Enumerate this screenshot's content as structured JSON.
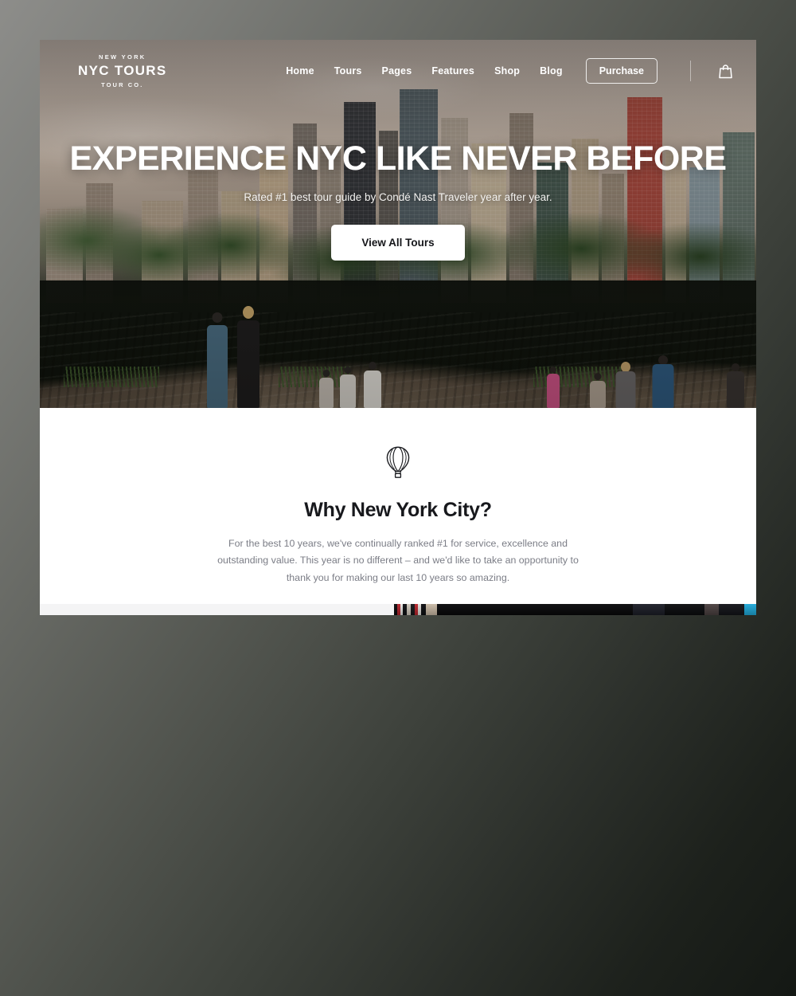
{
  "brand": {
    "top_line": "NEW YORK",
    "name": "NYC TOURS",
    "sub_line": "TOUR CO."
  },
  "nav": {
    "items": [
      {
        "label": "Home"
      },
      {
        "label": "Tours"
      },
      {
        "label": "Pages"
      },
      {
        "label": "Features"
      },
      {
        "label": "Shop"
      },
      {
        "label": "Blog"
      }
    ],
    "purchase_label": "Purchase",
    "cart_icon": "shopping-bag-icon"
  },
  "hero": {
    "title": "EXPERIENCE NYC LIKE NEVER BEFORE",
    "subtitle": "Rated #1 best tour guide by Condé Nast Traveler year after year.",
    "cta_label": "View All Tours"
  },
  "why_section": {
    "icon": "hot-air-balloon-icon",
    "title": "Why New York City?",
    "body": "For the best 10 years, we've continually ranked #1 for service, excellence and outstanding value. This year is no different – and we'd like to take an opportunity to thank you for making our last 10 years so amazing."
  },
  "colors": {
    "page_background": "#ffffff",
    "text_dark": "#17181c",
    "text_muted": "#7b7d86",
    "hero_text": "#ffffff",
    "cta_background": "#ffffff"
  }
}
